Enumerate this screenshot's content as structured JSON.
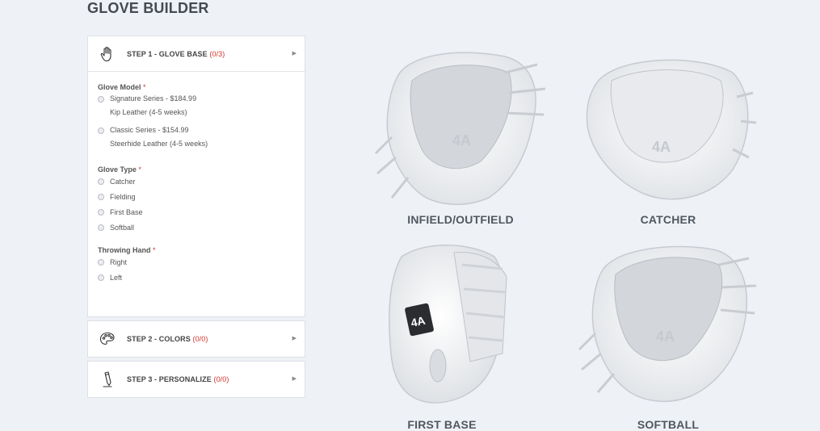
{
  "page": {
    "title": "GLOVE BUILDER"
  },
  "steps": [
    {
      "label": "STEP 1 - GLOVE BASE",
      "count": "(0/3)",
      "icon": "hand-icon"
    },
    {
      "label": "STEP 2 - COLORS",
      "count": "(0/0)",
      "icon": "palette-icon"
    },
    {
      "label": "STEP 3 - PERSONALIZE",
      "count": "(0/0)",
      "icon": "pencil-icon"
    }
  ],
  "glove_model": {
    "label": "Glove Model",
    "required": "*",
    "options": [
      {
        "name": "Signature Series - $184.99",
        "detail": "Kip Leather (4-5 weeks)"
      },
      {
        "name": "Classic Series - $154.99",
        "detail": "Steerhide Leather (4-5 weeks)"
      }
    ]
  },
  "glove_type": {
    "label": "Glove Type",
    "required": "*",
    "options": [
      "Catcher",
      "Fielding",
      "First Base",
      "Softball"
    ]
  },
  "throwing_hand": {
    "label": "Throwing Hand",
    "required": "*",
    "options": [
      "Right",
      "Left"
    ]
  },
  "gloves": [
    {
      "label": "INFIELD/OUTFIELD"
    },
    {
      "label": "CATCHER"
    },
    {
      "label": "FIRST BASE"
    },
    {
      "label": "SOFTBALL"
    }
  ],
  "colors": {
    "accent": "#d0342c",
    "background": "#eef1f5",
    "panel": "#ffffff"
  }
}
